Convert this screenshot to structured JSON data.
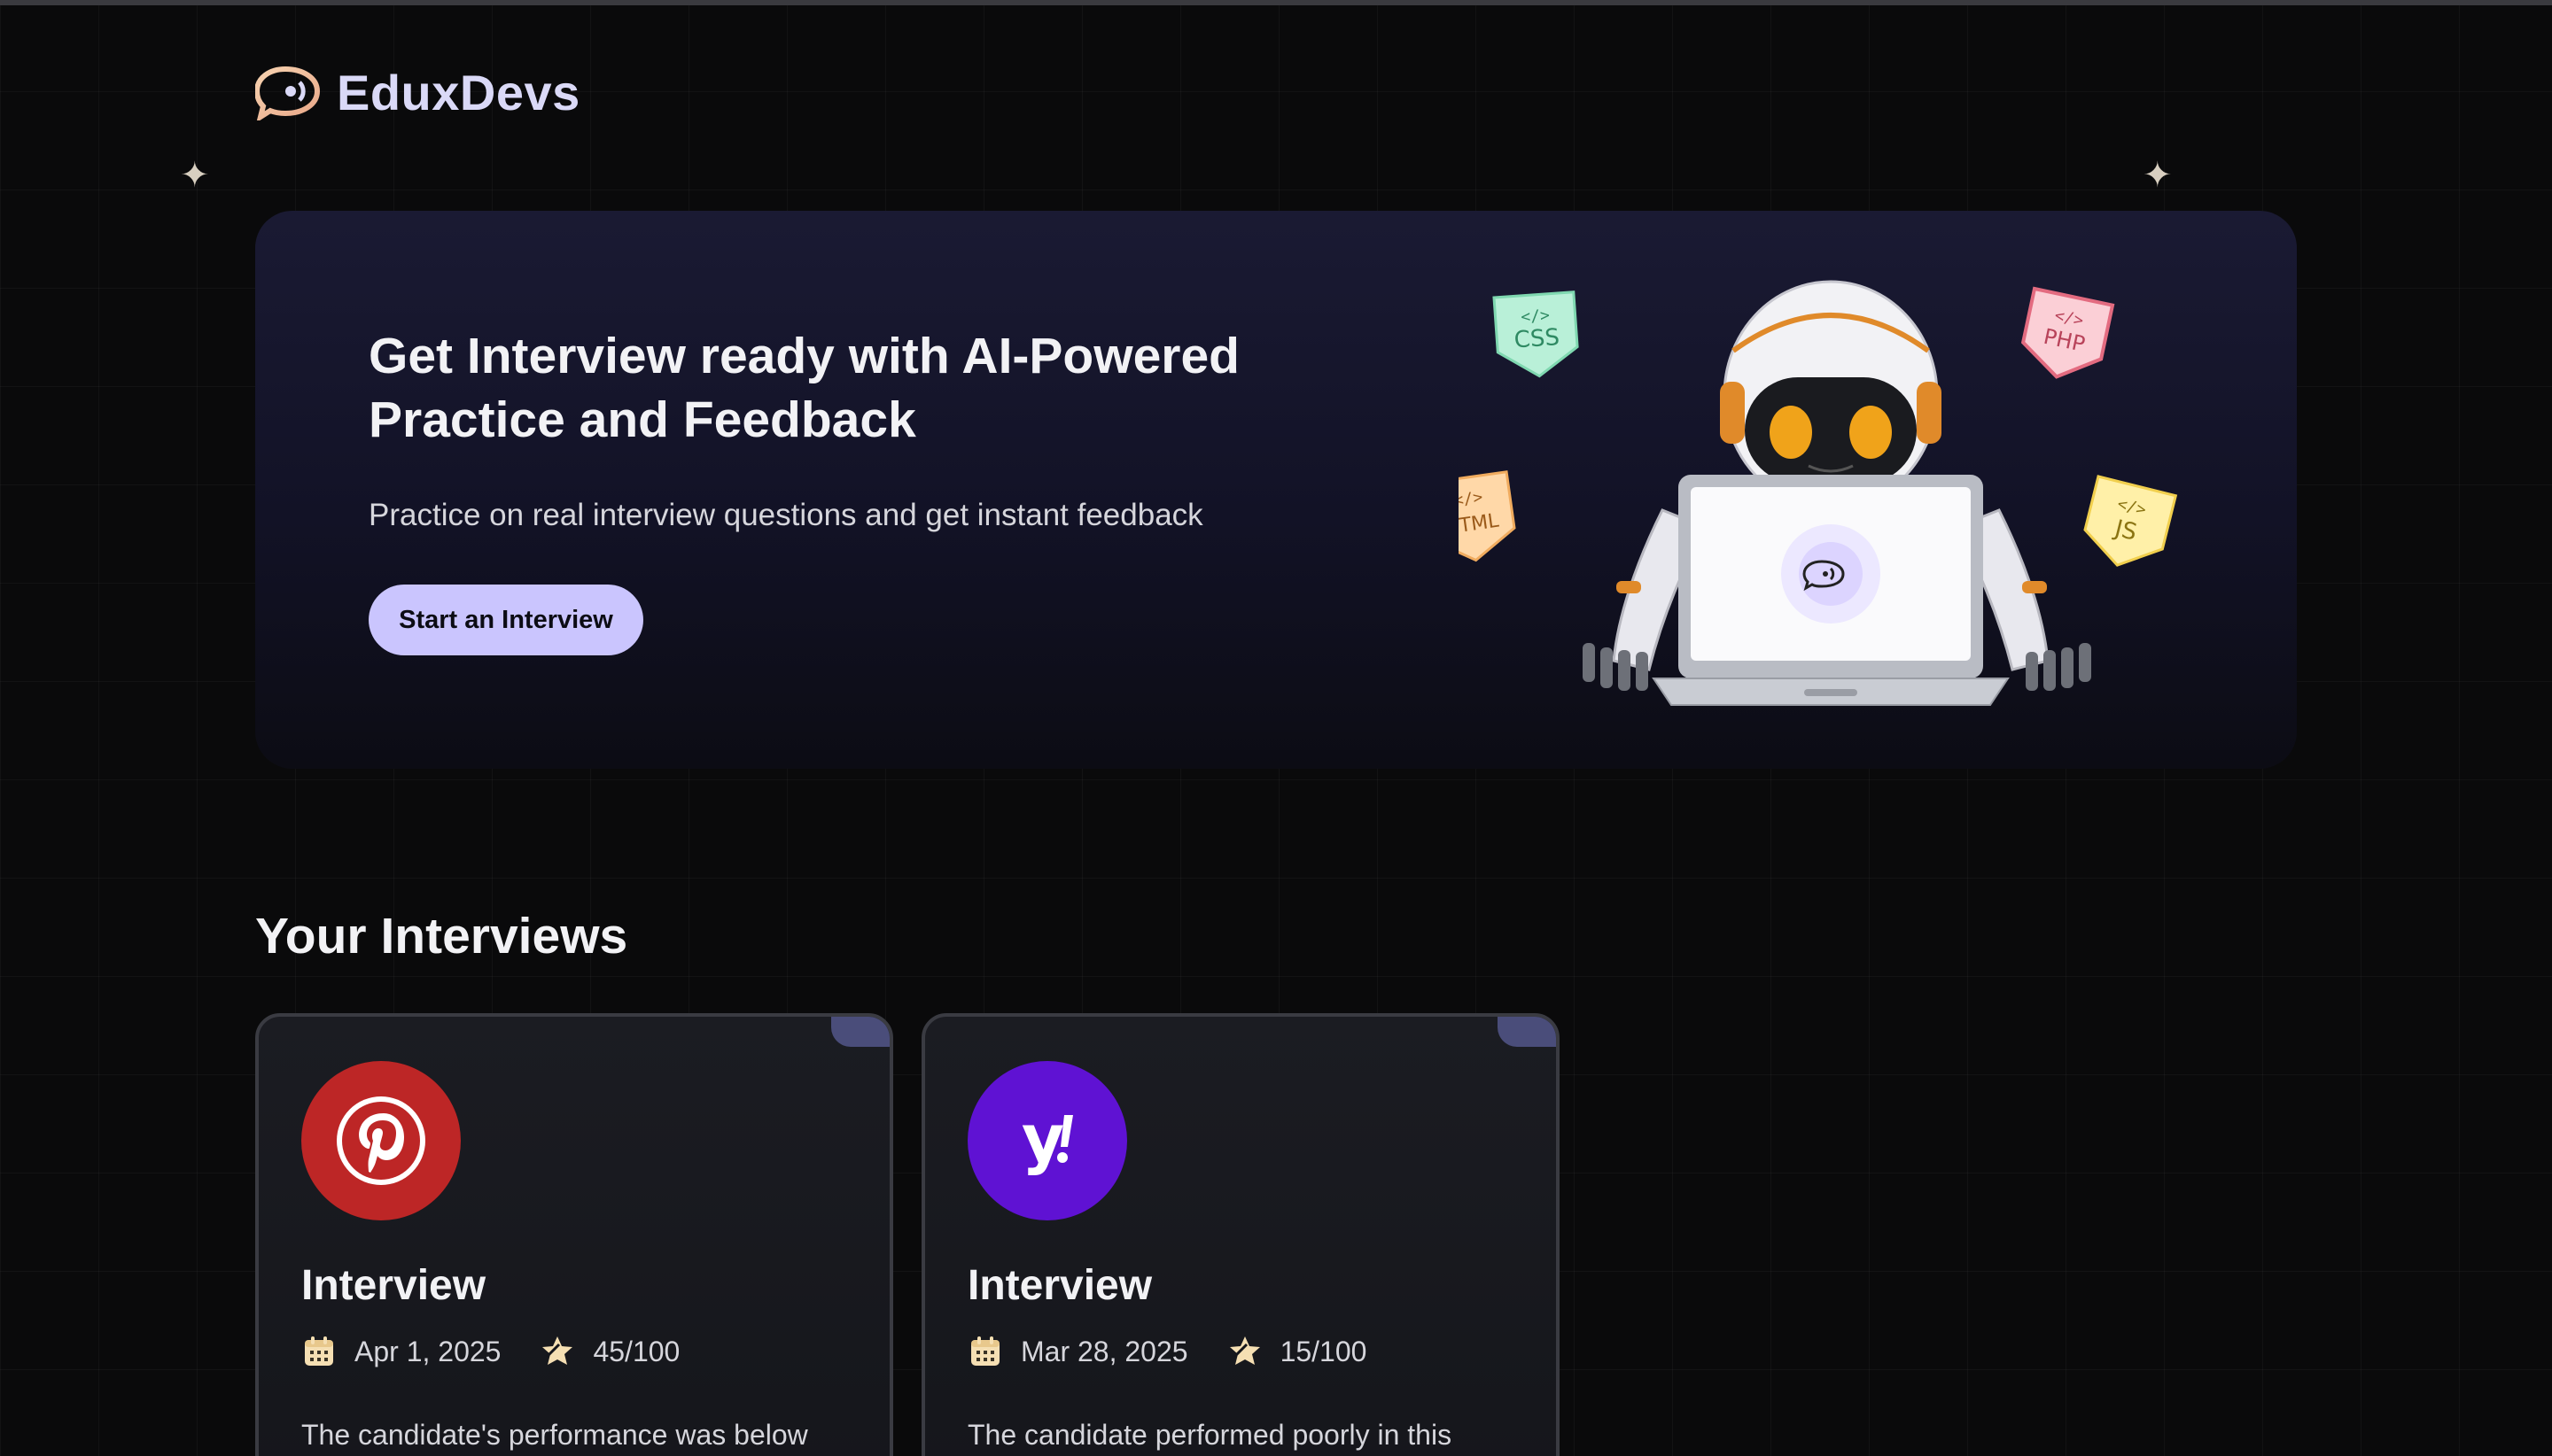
{
  "brand": {
    "name": "EduxDevs",
    "logo_icon": "chat-bubble-icon",
    "accent": "#f0c8a0"
  },
  "hero": {
    "title": "Get Interview ready with AI-Powered Practice and Feedback",
    "subtitle": "Practice on real interview questions and get instant feedback",
    "cta_label": "Start an Interview",
    "cta_color": "#cac5fe",
    "illustration": {
      "icon": "robot-with-laptop-icon",
      "tags": [
        "CSS",
        "PHP",
        "HTML",
        "JS"
      ]
    }
  },
  "interviews": {
    "section_title": "Your Interviews",
    "cards": [
      {
        "company_icon": "pinterest-logo-icon",
        "logo_color": "#bd2626",
        "title": "Interview",
        "date": "Apr 1, 2025",
        "score": "45/100",
        "description": "The candidate's performance was below"
      },
      {
        "company_icon": "yahoo-logo-icon",
        "logo_color": "#5f12d3",
        "title": "Interview",
        "date": "Mar 28, 2025",
        "score": "15/100",
        "description": "The candidate performed poorly in this"
      }
    ]
  }
}
